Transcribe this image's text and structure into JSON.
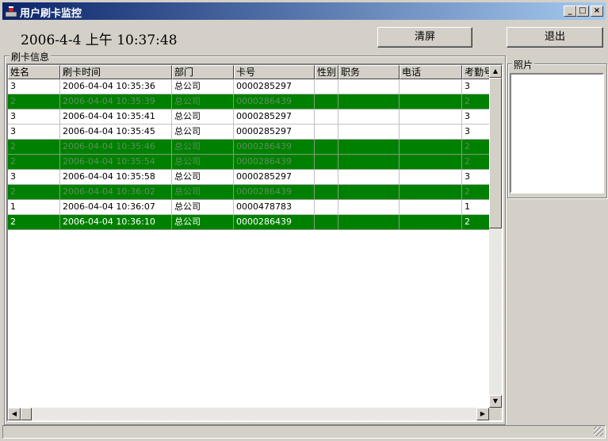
{
  "window": {
    "title": "用户刷卡监控",
    "controls": [
      "_",
      "□",
      "×"
    ]
  },
  "header": {
    "datetime": "2006-4-4 上午 10:37:48",
    "clear_label": "清屏",
    "exit_label": "退出"
  },
  "card_group": {
    "label": "刷卡信息"
  },
  "photo_group": {
    "label": "照片"
  },
  "table": {
    "columns": [
      "姓名",
      "刷卡时间",
      "部门",
      "卡号",
      "性别",
      "职务",
      "电话",
      "考勤号"
    ],
    "rows": [
      {
        "cells": [
          "3",
          "2006-04-04 10:35:36",
          "总公司",
          "0000285297",
          "",
          "",
          "",
          "3"
        ],
        "highlight": false
      },
      {
        "cells": [
          "2",
          "2006-04-04 10:35:39",
          "总公司",
          "0000286439",
          "",
          "",
          "",
          "2"
        ],
        "highlight": true
      },
      {
        "cells": [
          "3",
          "2006-04-04 10:35:41",
          "总公司",
          "0000285297",
          "",
          "",
          "",
          "3"
        ],
        "highlight": false
      },
      {
        "cells": [
          "3",
          "2006-04-04 10:35:45",
          "总公司",
          "0000285297",
          "",
          "",
          "",
          "3"
        ],
        "highlight": false
      },
      {
        "cells": [
          "2",
          "2006-04-04 10:35:46",
          "总公司",
          "0000286439",
          "",
          "",
          "",
          "2"
        ],
        "highlight": true
      },
      {
        "cells": [
          "2",
          "2006-04-04 10:35:54",
          "总公司",
          "0000286439",
          "",
          "",
          "",
          "2"
        ],
        "highlight": true
      },
      {
        "cells": [
          "3",
          "2006-04-04 10:35:58",
          "总公司",
          "0000285297",
          "",
          "",
          "",
          "3"
        ],
        "highlight": false
      },
      {
        "cells": [
          "2",
          "2006-04-04 10:36:02",
          "总公司",
          "0000286439",
          "",
          "",
          "",
          "2"
        ],
        "highlight": true
      },
      {
        "cells": [
          "1",
          "2006-04-04 10:36:07",
          "总公司",
          "0000478783",
          "",
          "",
          "",
          "1"
        ],
        "highlight": false
      },
      {
        "cells": [
          "2",
          "2006-04-04 10:36:10",
          "总公司",
          "0000286439",
          "",
          "",
          "",
          "2"
        ],
        "highlight": true,
        "selected": true
      }
    ]
  },
  "colors": {
    "highlight_row": "#008000",
    "titlebar_start": "#0a246a",
    "titlebar_end": "#a6caf0"
  },
  "icons": {
    "app": "user-card-icon",
    "scroll_up": "arrow-up-icon",
    "scroll_down": "arrow-down-icon",
    "scroll_left": "arrow-left-icon",
    "scroll_right": "arrow-right-icon"
  }
}
